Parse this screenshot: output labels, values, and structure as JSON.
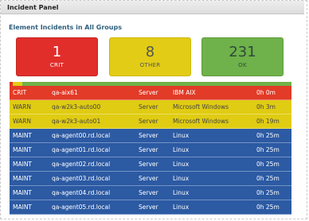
{
  "panel": {
    "title": "Incident Panel"
  },
  "section": {
    "title": "Element Incidents in All Groups"
  },
  "tiles": [
    {
      "count": "1",
      "label": "CRIT"
    },
    {
      "count": "8",
      "label": "OTHER"
    },
    {
      "count": "231",
      "label": "OK"
    }
  ],
  "status_bar": {
    "crit_color": "#e12e2b",
    "other_color": "#e3cc16",
    "ok_color": "#6fb14a",
    "crit_count": 1,
    "other_count": 8,
    "ok_count": 231
  },
  "incidents": [
    {
      "severity": "CRIT",
      "host": "qa-aix61",
      "type": "Server",
      "os": "IBM AIX",
      "duration": "0h 0m"
    },
    {
      "severity": "WARN",
      "host": "qa-w2k3-auto00",
      "type": "Server",
      "os": "Microsoft Windows",
      "duration": "0h 3m"
    },
    {
      "severity": "WARN",
      "host": "qa-w2k3-auto01",
      "type": "Server",
      "os": "Microsoft Windows",
      "duration": "0h 19m"
    },
    {
      "severity": "MAINT",
      "host": "qa-agent00.rd.local",
      "type": "Server",
      "os": "Linux",
      "duration": "0h 25m"
    },
    {
      "severity": "MAINT",
      "host": "qa-agent01.rd.local",
      "type": "Server",
      "os": "Linux",
      "duration": "0h 25m"
    },
    {
      "severity": "MAINT",
      "host": "qa-agent02.rd.local",
      "type": "Server",
      "os": "Linux",
      "duration": "0h 25m"
    },
    {
      "severity": "MAINT",
      "host": "qa-agent03.rd.local",
      "type": "Server",
      "os": "Linux",
      "duration": "0h 25m"
    },
    {
      "severity": "MAINT",
      "host": "qa-agent04.rd.local",
      "type": "Server",
      "os": "Linux",
      "duration": "0h 25m"
    },
    {
      "severity": "MAINT",
      "host": "qa-agent05.rd.local",
      "type": "Server",
      "os": "Linux",
      "duration": "0h 25m"
    }
  ]
}
